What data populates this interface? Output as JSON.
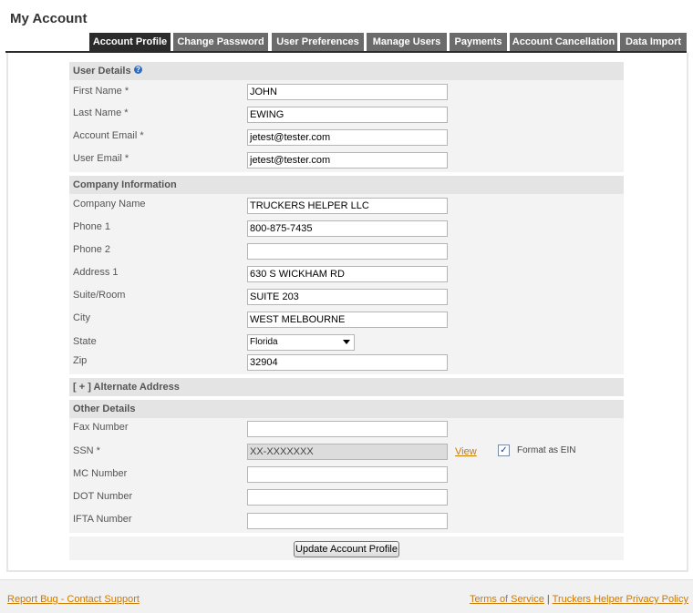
{
  "page": {
    "title": "My Account"
  },
  "tabs": [
    {
      "label": "Account Profile",
      "active": true
    },
    {
      "label": "Change Password"
    },
    {
      "label": "User Preferences"
    },
    {
      "label": "Manage Users"
    },
    {
      "label": "Payments"
    },
    {
      "label": "Account Cancellation"
    },
    {
      "label": "Data Import"
    }
  ],
  "user_details": {
    "heading": "User Details",
    "help_icon": "?",
    "fields": [
      {
        "label": "First Name *",
        "value": "JOHN"
      },
      {
        "label": "Last Name *",
        "value": "EWING"
      },
      {
        "label": "Account Email *",
        "value": "jetest@tester.com"
      },
      {
        "label": "User Email *",
        "value": "jetest@tester.com"
      }
    ]
  },
  "company": {
    "heading": "Company Information",
    "fields": [
      {
        "label": "Company Name",
        "value": "TRUCKERS HELPER LLC"
      },
      {
        "label": "Phone 1",
        "value": "800-875-7435"
      },
      {
        "label": "Phone 2",
        "value": ""
      },
      {
        "label": "Address 1",
        "value": "630 S WICKHAM RD"
      },
      {
        "label": "Suite/Room",
        "value": "SUITE 203"
      },
      {
        "label": "City",
        "value": "WEST MELBOURNE"
      }
    ],
    "state_label": "State",
    "state_value": "Florida",
    "zip_label": "Zip",
    "zip_value": "32904"
  },
  "alternate_address": {
    "heading": "[ + ] Alternate Address"
  },
  "other": {
    "heading": "Other Details",
    "fax_label": "Fax Number",
    "fax_value": "",
    "ssn_label": "SSN *",
    "ssn_value": "XX-XXXXXXX",
    "view_link": "View",
    "ein_checkbox_label": "Format as EIN",
    "ein_checked": true,
    "ein_check_glyph": "✓",
    "mc_label": "MC Number",
    "mc_value": "",
    "dot_label": "DOT Number",
    "dot_value": "",
    "ifta_label": "IFTA Number",
    "ifta_value": ""
  },
  "actions": {
    "submit_label": "Update Account Profile"
  },
  "footer": {
    "report_bug": "Report Bug - Contact Support",
    "terms": "Terms of Service",
    "separator": "|",
    "privacy": "Truckers Helper Privacy Policy"
  },
  "colors": {
    "tab_active": "#2b2b2b",
    "tab_inactive": "#6b6b6b",
    "link": "#cc7a00",
    "section_head": "#e4e4e4",
    "section_body": "#f3f3f3"
  }
}
